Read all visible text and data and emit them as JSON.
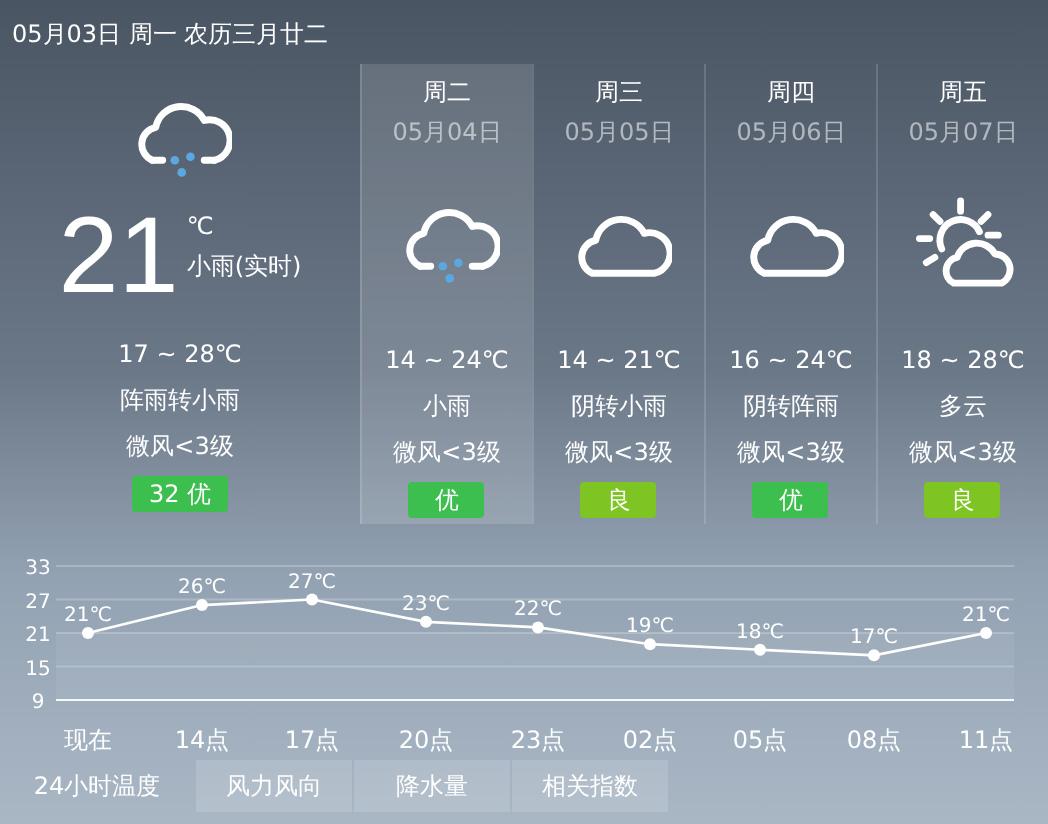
{
  "header": {
    "date_line": "05月03日 周一 农历三月廿二"
  },
  "current": {
    "kind": "rain",
    "temperature": "21",
    "unit": "℃",
    "condition": "小雨(实时)",
    "range": "17 ~ 28℃",
    "description": "阵雨转小雨",
    "wind": "微风<3级",
    "aqi": {
      "label": "32 优",
      "color": "#3cbf4e"
    }
  },
  "days": [
    {
      "weekday": "周二",
      "date": "05月04日",
      "kind": "rain",
      "range": "14 ~ 24℃",
      "description": "小雨",
      "wind": "微风<3级",
      "aqi": {
        "label": "优",
        "color": "#3cbf4e"
      },
      "selected": true
    },
    {
      "weekday": "周三",
      "date": "05月05日",
      "kind": "cloudy",
      "range": "14 ~ 21℃",
      "description": "阴转小雨",
      "wind": "微风<3级",
      "aqi": {
        "label": "良",
        "color": "#7ec423"
      },
      "selected": false
    },
    {
      "weekday": "周四",
      "date": "05月06日",
      "kind": "cloudy",
      "range": "16 ~ 24℃",
      "description": "阴转阵雨",
      "wind": "微风<3级",
      "aqi": {
        "label": "优",
        "color": "#3cbf4e"
      },
      "selected": false
    },
    {
      "weekday": "周五",
      "date": "05月07日",
      "kind": "partly_cloudy",
      "range": "18 ~ 28℃",
      "description": "多云",
      "wind": "微风<3级",
      "aqi": {
        "label": "良",
        "color": "#7ec423"
      },
      "selected": false
    }
  ],
  "chart_data": {
    "type": "line",
    "categories": [
      "现在",
      "14点",
      "17点",
      "20点",
      "23点",
      "02点",
      "05点",
      "08点",
      "11点"
    ],
    "series": [
      {
        "color": "#ffffff",
        "marker": "circle",
        "values": [
          21,
          26,
          27,
          23,
          22,
          19,
          18,
          17,
          21
        ]
      }
    ],
    "grid": true,
    "ylim": [
      9,
      33
    ],
    "yticks": [
      9,
      15,
      21,
      27,
      33
    ],
    "value_labels": [
      "21℃",
      "26℃",
      "27℃",
      "23℃",
      "22℃",
      "19℃",
      "18℃",
      "17℃",
      "21℃"
    ]
  },
  "tabs": [
    {
      "label": "24小时温度",
      "selected": true
    },
    {
      "label": "风力风向",
      "selected": false
    },
    {
      "label": "降水量",
      "selected": false
    },
    {
      "label": "相关指数",
      "selected": false
    }
  ]
}
